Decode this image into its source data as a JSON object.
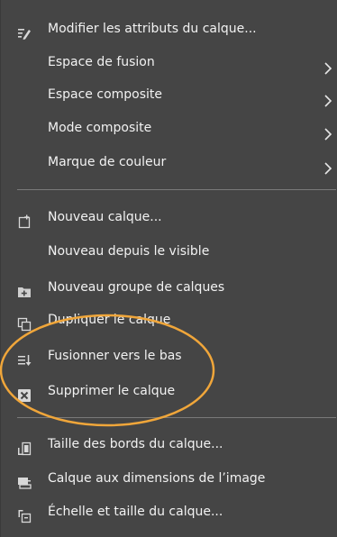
{
  "menu": {
    "items": [
      {
        "label": "Modifier les attributs du calque...",
        "icon": "edit-attributes-icon"
      },
      {
        "label": "Espace de fusion",
        "has_submenu": true
      },
      {
        "label": "Espace composite",
        "has_submenu": true
      },
      {
        "label": "Mode composite",
        "has_submenu": true
      },
      {
        "label": "Marque de couleur",
        "has_submenu": true
      },
      {
        "label": "Nouveau calque...",
        "icon": "new-layer-icon"
      },
      {
        "label": "Nouveau depuis le visible"
      },
      {
        "label": "Nouveau groupe de calques",
        "icon": "new-layer-group-icon"
      },
      {
        "label": "Dupliquer le calque",
        "icon": "duplicate-layer-icon"
      },
      {
        "label": "Fusionner vers le bas",
        "icon": "merge-down-icon"
      },
      {
        "label": "Supprimer le calque",
        "icon": "delete-layer-icon"
      },
      {
        "label": "Taille des bords du calque...",
        "icon": "layer-boundary-size-icon"
      },
      {
        "label": "Calque aux dimensions de l’image",
        "icon": "layer-to-image-size-icon"
      },
      {
        "label": "Échelle et taille du calque...",
        "icon": "scale-layer-icon"
      }
    ]
  },
  "colors": {
    "menu_background": "#454545",
    "text": "#f2f2f2",
    "separator": "#7a7a7a",
    "highlight_ellipse": "#f0a63a"
  }
}
